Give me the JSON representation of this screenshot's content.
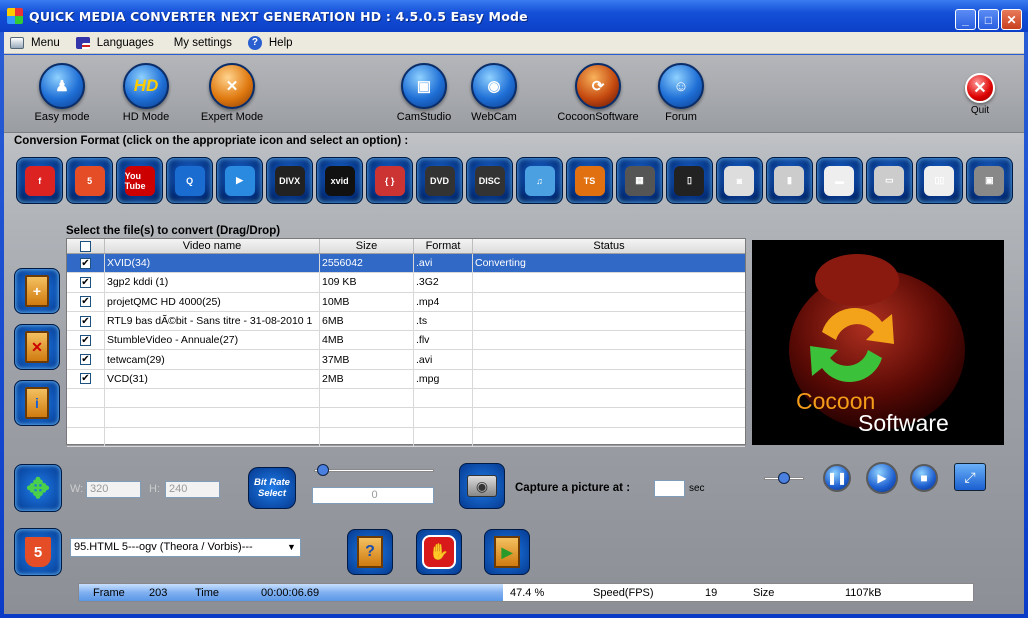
{
  "window": {
    "title": "QUICK MEDIA CONVERTER NEXT GENERATION HD : 4.5.0.5 Easy Mode",
    "controls": [
      "minimize",
      "maximize",
      "close"
    ]
  },
  "menu": {
    "items": [
      {
        "label": "Menu",
        "icon": "menu-icon"
      },
      {
        "label": "Languages",
        "icon": "flag-icon"
      },
      {
        "label": "My settings",
        "icon": ""
      },
      {
        "label": "Help",
        "icon": "help-icon"
      }
    ]
  },
  "toolbar": {
    "easy_mode": "Easy mode",
    "hd_mode": "HD Mode",
    "hd_badge": "HD",
    "expert_mode": "Expert Mode",
    "camstudio": "CamStudio",
    "webcam": "WebCam",
    "cocoon": "CocoonSoftware",
    "forum": "Forum",
    "quit": "Quit"
  },
  "conversion": {
    "label": "Conversion Format (click on the appropriate icon and select an option) :",
    "formats": [
      {
        "name": "flash",
        "text": "f",
        "color": "#d22"
      },
      {
        "name": "html5",
        "text": "5",
        "color": "#e44d26"
      },
      {
        "name": "youtube",
        "text": "You Tube",
        "color": "#c00"
      },
      {
        "name": "quicktime",
        "text": "Q",
        "color": "#1a6cd0"
      },
      {
        "name": "windows-media",
        "text": "▶",
        "color": "#2a8ae0"
      },
      {
        "name": "divx",
        "text": "DIVX",
        "color": "#222"
      },
      {
        "name": "xvid",
        "text": "xvid",
        "color": "#111"
      },
      {
        "name": "matroska",
        "text": "{ }",
        "color": "#c33"
      },
      {
        "name": "dvd",
        "text": "DVD",
        "color": "#333"
      },
      {
        "name": "vcd",
        "text": "DISC",
        "color": "#333"
      },
      {
        "name": "itunes",
        "text": "♫",
        "color": "#4aa0e0"
      },
      {
        "name": "ts",
        "text": "TS",
        "color": "#e07010"
      },
      {
        "name": "phone",
        "text": "▦",
        "color": "#555"
      },
      {
        "name": "iphone",
        "text": "▯",
        "color": "#222"
      },
      {
        "name": "ipod",
        "text": "◙",
        "color": "#ddd"
      },
      {
        "name": "xbox",
        "text": "▮",
        "color": "#ccc"
      },
      {
        "name": "psp",
        "text": "▬",
        "color": "#eee"
      },
      {
        "name": "playstation",
        "text": "▭",
        "color": "#ccc"
      },
      {
        "name": "wii",
        "text": "▯▯",
        "color": "#eee"
      },
      {
        "name": "nintendo-ds",
        "text": "▣",
        "color": "#888"
      }
    ]
  },
  "files": {
    "label": "Select the  file(s) to convert (Drag/Drop)",
    "columns": [
      "",
      "Video name",
      "Size",
      "Format",
      "Status"
    ],
    "rows": [
      {
        "name": "XVID(34)",
        "size": "2556042",
        "format": ".avi",
        "status": "Converting",
        "selected": true
      },
      {
        "name": "3gp2 kddi (1)",
        "size": "109 KB",
        "format": ".3G2",
        "status": ""
      },
      {
        "name": "projetQMC HD 4000(25)",
        "size": "10MB",
        "format": ".mp4",
        "status": ""
      },
      {
        "name": "RTL9 bas dÃ©bit - Sans titre - 31-08-2010 1",
        "size": "6MB",
        "format": ".ts",
        "status": ""
      },
      {
        "name": "StumbleVideo -  Annuale(27)",
        "size": "4MB",
        "format": ".flv",
        "status": ""
      },
      {
        "name": "tetwcam(29)",
        "size": "37MB",
        "format": ".avi",
        "status": ""
      },
      {
        "name": "VCD(31)",
        "size": "2MB",
        "format": ".mpg",
        "status": ""
      }
    ]
  },
  "preview": {
    "brand1": "Cocoon",
    "brand2": "Software"
  },
  "controls": {
    "w_label": "W:",
    "w_value": "320",
    "h_label": "H:",
    "h_value": "240",
    "bitrate_label": "Bit Rate Select",
    "slider_value": "0",
    "capture_label": "Capture a picture at :",
    "sec_label": "sec"
  },
  "output": {
    "selected": "95.HTML 5---ogv (Theora / Vorbis)---"
  },
  "status": {
    "frame_label": "Frame",
    "frame_value": "203",
    "time_label": "Time",
    "time_value": "00:00:06.69",
    "progress_text": "47.4 %",
    "progress": 0.474,
    "speed_label": "Speed(FPS)",
    "speed_value": "19",
    "size_label": "Size",
    "size_value": "1107kB"
  }
}
